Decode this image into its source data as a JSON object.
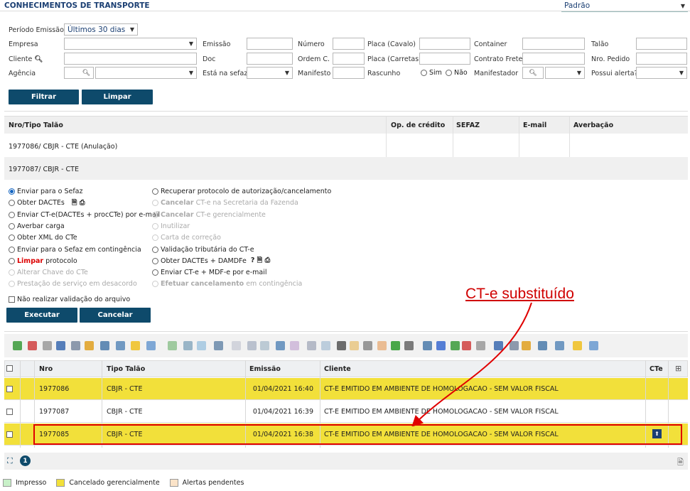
{
  "title": "CONHECIMENTOS DE TRANSPORTE",
  "view_select": "Padrão",
  "filters": {
    "periodo_label": "Período Emissão",
    "periodo_value": "Últimos 30 dias",
    "empresa": "Empresa",
    "emissao": "Emissão",
    "numero": "Número",
    "placa_cavalo": "Placa (Cavalo)",
    "container": "Container",
    "talao": "Talão",
    "cliente": "Cliente",
    "doc": "Doc",
    "ordem_c": "Ordem C.",
    "placa_carretas": "Placa (Carretas)",
    "contrato_frete": "Contrato Frete",
    "nro_pedido": "Nro. Pedido",
    "agencia": "Agência",
    "esta_sefaz": "Está na sefaz?",
    "manifesto": "Manifesto",
    "rascunho": "Rascunho",
    "sim": "Sim",
    "nao": "Não",
    "manifestador": "Manifestador",
    "possui_alerta": "Possui alerta?",
    "filtrar": "Filtrar",
    "limpar": "Limpar"
  },
  "upper_table": {
    "headers": [
      "Nro/Tipo Talão",
      "Op. de crédito",
      "SEFAZ",
      "E-mail",
      "Averbação"
    ],
    "rows": [
      "1977086/ CBJR - CTE  (Anulação)",
      "1977087/ CBJR - CTE"
    ]
  },
  "actions": {
    "left": [
      {
        "label": "Enviar para o Sefaz",
        "state": "selected"
      },
      {
        "label": "Obter DACTEs",
        "state": "normal"
      },
      {
        "label": "Enviar CT-e(DACTEs + procCTe) por e-mail",
        "state": "normal"
      },
      {
        "label": "Averbar carga",
        "state": "normal"
      },
      {
        "label": "Obter XML do CTe",
        "state": "normal"
      },
      {
        "label": "Enviar para o Sefaz em contingência",
        "state": "normal"
      },
      {
        "label": "protocolo",
        "state": "normal",
        "prefix": "Limpar"
      },
      {
        "label": "Alterar Chave do CTe",
        "state": "disabled"
      },
      {
        "label": "Prestação de serviço em desacordo",
        "state": "disabled"
      }
    ],
    "right": [
      {
        "label": "Recuperar protocolo de autorização/cancelamento",
        "state": "normal"
      },
      {
        "label": "CT-e na Secretaria da Fazenda",
        "state": "disabled",
        "prefix": "Cancelar"
      },
      {
        "label": "CT-e gerencialmente",
        "state": "disabled",
        "prefix": "Cancelar"
      },
      {
        "label": "Inutilizar",
        "state": "disabled"
      },
      {
        "label": "Carta de correção",
        "state": "disabled"
      },
      {
        "label": "Validação tributária do CT-e",
        "state": "normal"
      },
      {
        "label": "Obter DACTEs + DAMDFe",
        "state": "normal"
      },
      {
        "label": "Enviar CT-e + MDF-e por e-mail",
        "state": "normal"
      },
      {
        "label": "em contingência",
        "state": "disabled",
        "prefix": "Efetuar",
        "bold": "cancelamento"
      }
    ],
    "nao_validar": "Não realizar validação do arquivo",
    "executar": "Executar",
    "cancelar": "Cancelar"
  },
  "annotation": "CT-e substituído",
  "grid": {
    "headers": [
      "Nro",
      "Tipo Talão",
      "Emissão",
      "Cliente",
      "CTe"
    ],
    "rows": [
      {
        "nro": "1977086",
        "tipo": "CBJR - CTE",
        "emissao": "01/04/2021 16:40",
        "cliente": "CT-E EMITIDO EM AMBIENTE DE HOMOLOGACAO - SEM VALOR FISCAL"
      },
      {
        "nro": "1977087",
        "tipo": "CBJR - CTE",
        "emissao": "01/04/2021 16:39",
        "cliente": "CT-E EMITIDO EM AMBIENTE DE HOMOLOGACAO - SEM VALOR FISCAL"
      },
      {
        "nro": "1977085",
        "tipo": "CBJR - CTE",
        "emissao": "01/04/2021 16:38",
        "cliente": "CT-E EMITIDO EM AMBIENTE DE HOMOLOGACAO - SEM VALOR FISCAL"
      }
    ]
  },
  "pager": {
    "page": "1"
  },
  "legend": [
    "Impresso",
    "Cancelado gerencialmente",
    "Alertas pendentes"
  ],
  "colors": {
    "yellow": "#f2e03a",
    "impresso": "#c8f0c8",
    "alertas": "#fbe3c8",
    "accent": "#0e4a6b",
    "red": "#d00000"
  }
}
